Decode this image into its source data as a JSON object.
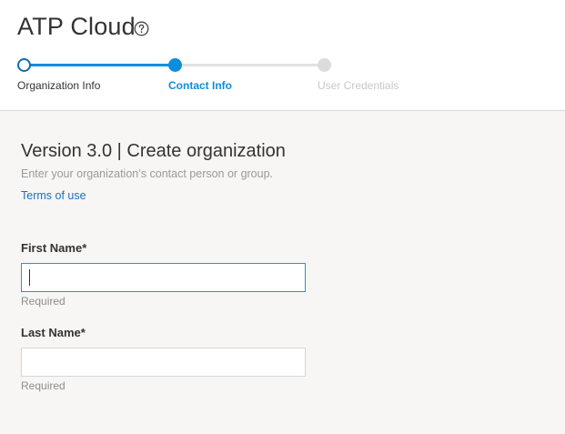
{
  "app": {
    "title": "ATP Cloud"
  },
  "stepper": {
    "steps": [
      {
        "label": "Organization Info",
        "state": "completed"
      },
      {
        "label": "Contact Info",
        "state": "active"
      },
      {
        "label": "User Credentials",
        "state": "pending"
      }
    ]
  },
  "form": {
    "title": "Version 3.0 | Create organization",
    "subtitle": "Enter your organization’s contact person or group.",
    "terms_link": "Terms of use",
    "fields": [
      {
        "label": "First Name*",
        "value": "",
        "hint": "Required"
      },
      {
        "label": "Last Name*",
        "value": "",
        "hint": "Required"
      }
    ]
  },
  "colors": {
    "accent": "#0b8fdc",
    "link": "#1f6fbf",
    "content_bg": "#f7f6f4",
    "pending": "#dcdcdc"
  },
  "icons": {
    "help": "help-circle-icon"
  }
}
